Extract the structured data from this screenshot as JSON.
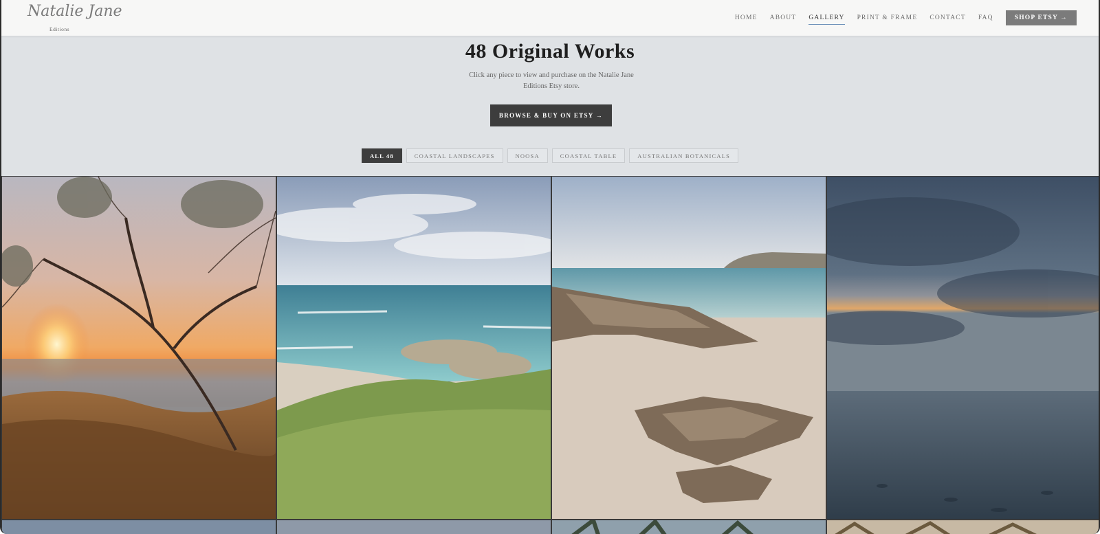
{
  "brand": {
    "script": "Natalie Jane",
    "sub": "Editions"
  },
  "nav": {
    "items": [
      "HOME",
      "ABOUT",
      "GALLERY",
      "PRINT & FRAME",
      "CONTACT",
      "FAQ"
    ],
    "active": "GALLERY",
    "shop_label": "SHOP ETSY →"
  },
  "hero": {
    "title": "48 Original Works",
    "description": "Click any piece to view and purchase on the Natalie Jane Editions Etsy store.",
    "browse_label": "BROWSE & BUY ON ETSY →"
  },
  "filters": {
    "items": [
      "ALL 48",
      "COASTAL LANDSCAPES",
      "NOOSA",
      "COASTAL TABLE",
      "AUSTRALIAN BOTANICALS"
    ],
    "active": "ALL 48"
  },
  "colors": {
    "page_bg": "#dfe2e5",
    "header_bg": "#f7f7f6",
    "dark_button": "#3d3d3d",
    "shop_button": "#7b7b7b",
    "nav_active_underline": "#6a8fb8"
  }
}
